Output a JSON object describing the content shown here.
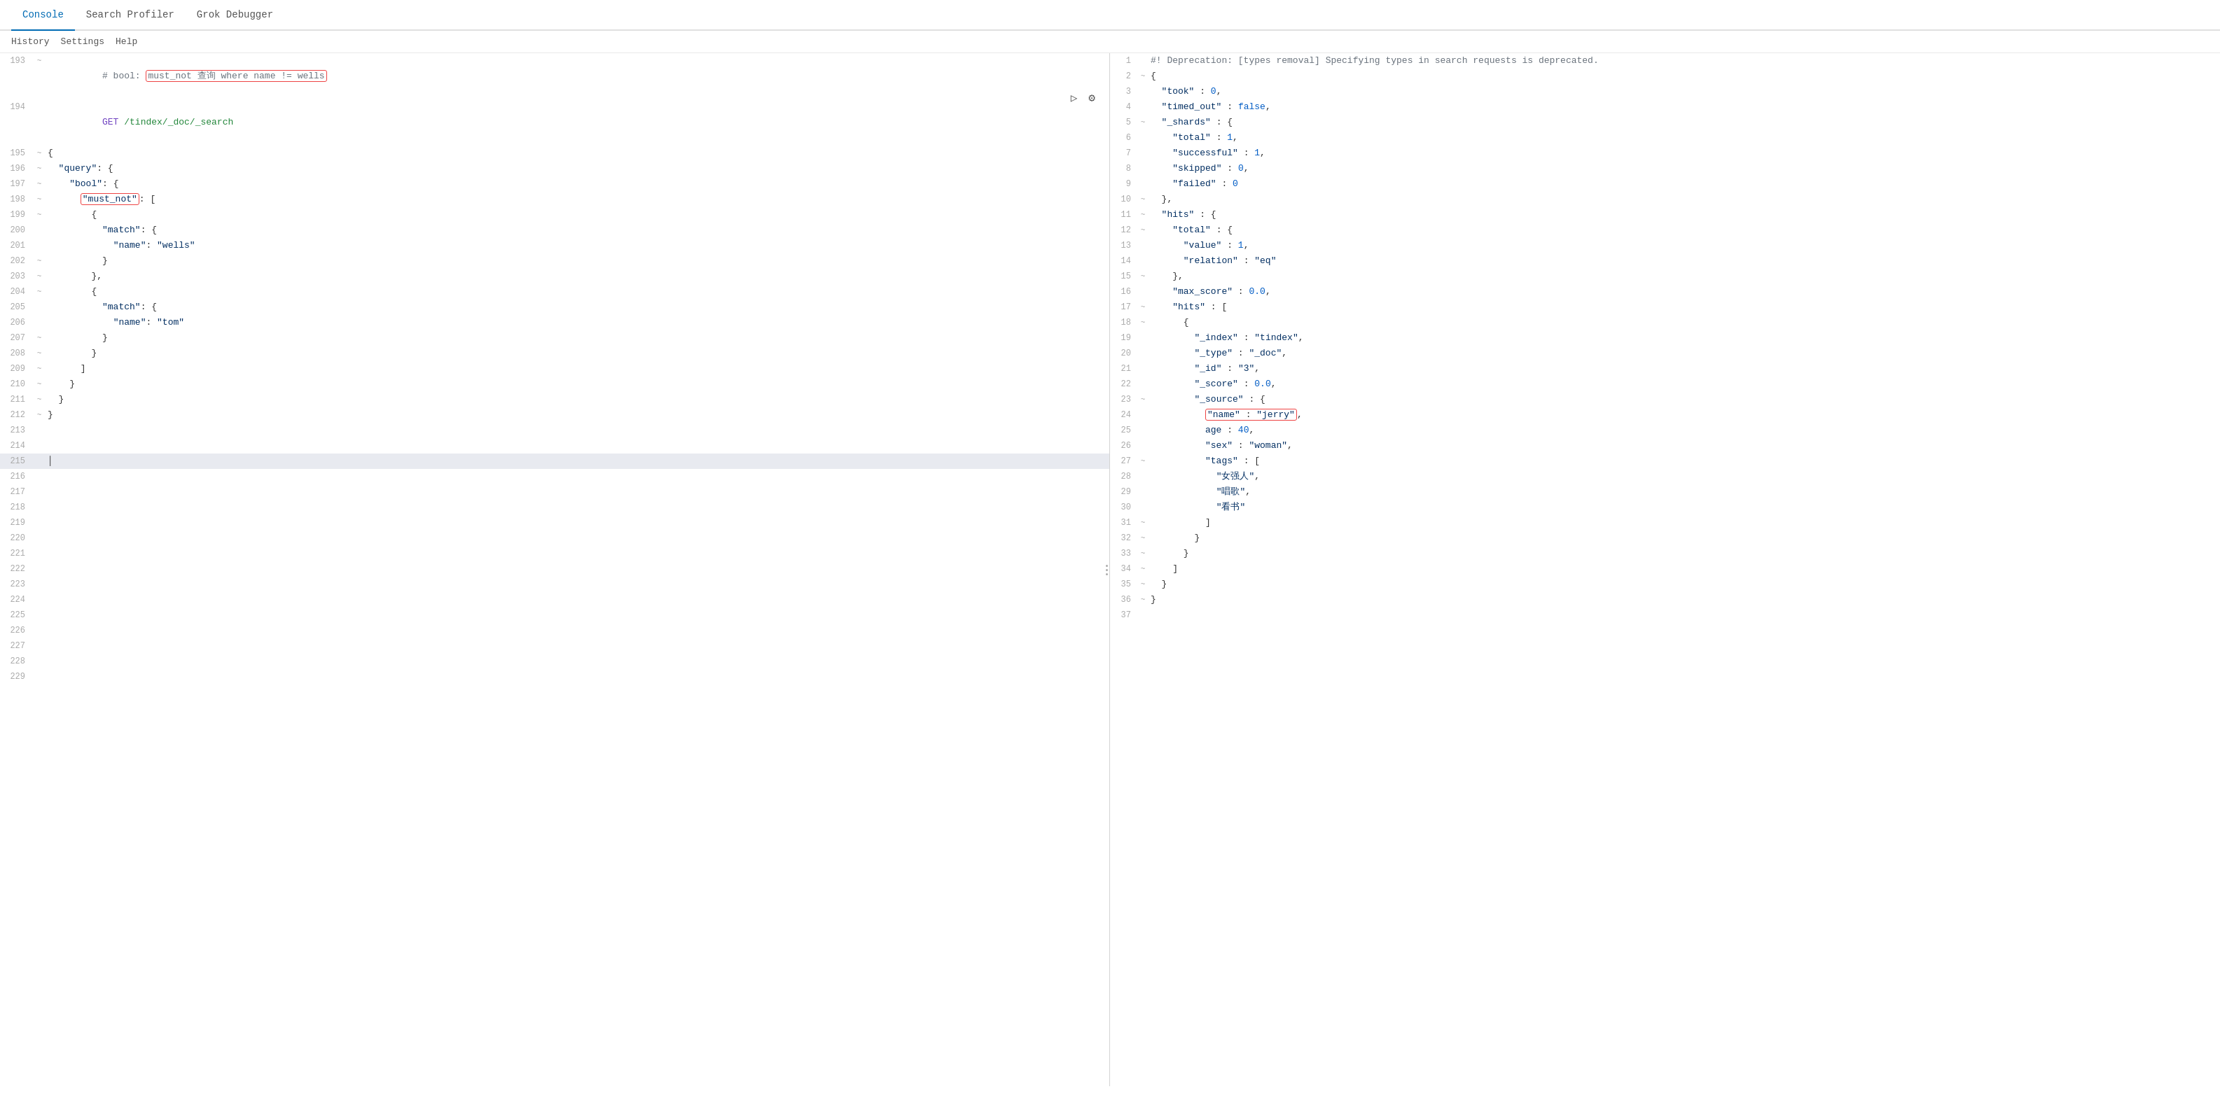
{
  "tabs": [
    {
      "label": "Console",
      "active": true
    },
    {
      "label": "Search Profiler",
      "active": false
    },
    {
      "label": "Grok Debugger",
      "active": false
    }
  ],
  "secondary_nav": [
    {
      "label": "History"
    },
    {
      "label": "Settings"
    },
    {
      "label": "Help"
    }
  ],
  "editor": {
    "lines": [
      {
        "num": 193,
        "fold": "~",
        "content": "# bool: ",
        "highlight": "must_not 查询 where name != wells",
        "highlighted": false,
        "comment": true
      },
      {
        "num": 194,
        "fold": null,
        "content": "GET /tindex/_doc/_search"
      },
      {
        "num": 195,
        "fold": "~",
        "content": "{"
      },
      {
        "num": 196,
        "fold": "~",
        "content": "  \"query\": {"
      },
      {
        "num": 197,
        "fold": "~",
        "content": "    \"bool\": {"
      },
      {
        "num": 198,
        "fold": "~",
        "content": "      \"must_not\": [",
        "boxed": true
      },
      {
        "num": 199,
        "fold": "~",
        "content": "        {"
      },
      {
        "num": 200,
        "fold": null,
        "content": "          \"match\": {"
      },
      {
        "num": 201,
        "fold": null,
        "content": "            \"name\": \"wells\""
      },
      {
        "num": 202,
        "fold": "~",
        "content": "          }"
      },
      {
        "num": 203,
        "fold": "~",
        "content": "        },"
      },
      {
        "num": 204,
        "fold": "~",
        "content": "        {"
      },
      {
        "num": 205,
        "fold": null,
        "content": "          \"match\": {"
      },
      {
        "num": 206,
        "fold": null,
        "content": "            \"name\": \"tom\""
      },
      {
        "num": 207,
        "fold": "~",
        "content": "          }"
      },
      {
        "num": 208,
        "fold": "~",
        "content": "        }"
      },
      {
        "num": 209,
        "fold": "~",
        "content": "      ]"
      },
      {
        "num": 210,
        "fold": "~",
        "content": "    }"
      },
      {
        "num": 211,
        "fold": "~",
        "content": "  }"
      },
      {
        "num": 212,
        "fold": "~",
        "content": "}"
      },
      {
        "num": 213,
        "fold": null,
        "content": ""
      },
      {
        "num": 214,
        "fold": null,
        "content": ""
      },
      {
        "num": 215,
        "fold": null,
        "content": "",
        "cursor": true
      },
      {
        "num": 216,
        "fold": null,
        "content": ""
      },
      {
        "num": 217,
        "fold": null,
        "content": ""
      },
      {
        "num": 218,
        "fold": null,
        "content": ""
      },
      {
        "num": 219,
        "fold": null,
        "content": ""
      },
      {
        "num": 220,
        "fold": null,
        "content": ""
      },
      {
        "num": 221,
        "fold": null,
        "content": ""
      },
      {
        "num": 222,
        "fold": null,
        "content": ""
      },
      {
        "num": 223,
        "fold": null,
        "content": ""
      },
      {
        "num": 224,
        "fold": null,
        "content": ""
      },
      {
        "num": 225,
        "fold": null,
        "content": ""
      },
      {
        "num": 226,
        "fold": null,
        "content": ""
      },
      {
        "num": 227,
        "fold": null,
        "content": ""
      },
      {
        "num": 228,
        "fold": null,
        "content": ""
      },
      {
        "num": 229,
        "fold": null,
        "content": ""
      }
    ]
  },
  "output": {
    "lines": [
      {
        "num": 1,
        "fold": null,
        "content": "#! Deprecation: [types removal] Specifying types in search requests is deprecated.",
        "comment": true
      },
      {
        "num": 2,
        "fold": "~",
        "content": "{"
      },
      {
        "num": 3,
        "fold": null,
        "content": "  \"took\" : 0,"
      },
      {
        "num": 4,
        "fold": null,
        "content": "  \"timed_out\" : false,"
      },
      {
        "num": 5,
        "fold": "~",
        "content": "  \"_shards\" : {"
      },
      {
        "num": 6,
        "fold": null,
        "content": "    \"total\" : 1,"
      },
      {
        "num": 7,
        "fold": null,
        "content": "    \"successful\" : 1,"
      },
      {
        "num": 8,
        "fold": null,
        "content": "    \"skipped\" : 0,"
      },
      {
        "num": 9,
        "fold": null,
        "content": "    \"failed\" : 0"
      },
      {
        "num": 10,
        "fold": "~",
        "content": "  },"
      },
      {
        "num": 11,
        "fold": "~",
        "content": "  \"hits\" : {"
      },
      {
        "num": 12,
        "fold": "~",
        "content": "    \"total\" : {"
      },
      {
        "num": 13,
        "fold": null,
        "content": "      \"value\" : 1,"
      },
      {
        "num": 14,
        "fold": null,
        "content": "      \"relation\" : \"eq\""
      },
      {
        "num": 15,
        "fold": "~",
        "content": "    },"
      },
      {
        "num": 16,
        "fold": null,
        "content": "    \"max_score\" : 0.0,"
      },
      {
        "num": 17,
        "fold": "~",
        "content": "    \"hits\" : ["
      },
      {
        "num": 18,
        "fold": "~",
        "content": "      {"
      },
      {
        "num": 19,
        "fold": null,
        "content": "        \"_index\" : \"tindex\","
      },
      {
        "num": 20,
        "fold": null,
        "content": "        \"_type\" : \"_doc\","
      },
      {
        "num": 21,
        "fold": null,
        "content": "        \"_id\" : \"3\","
      },
      {
        "num": 22,
        "fold": null,
        "content": "        \"_score\" : 0.0,"
      },
      {
        "num": 23,
        "fold": "~",
        "content": "        \"_source\" : {"
      },
      {
        "num": 24,
        "fold": null,
        "content": "          \"name\" : \"jerry\",",
        "boxed": true
      },
      {
        "num": 25,
        "fold": null,
        "content": "          age : 40,"
      },
      {
        "num": 26,
        "fold": null,
        "content": "          \"sex\" : \"woman\","
      },
      {
        "num": 27,
        "fold": "~",
        "content": "          \"tags\" : ["
      },
      {
        "num": 28,
        "fold": null,
        "content": "            \"女强人\","
      },
      {
        "num": 29,
        "fold": null,
        "content": "            \"唱歌\","
      },
      {
        "num": 30,
        "fold": null,
        "content": "            \"看书\""
      },
      {
        "num": 31,
        "fold": "~",
        "content": "          ]"
      },
      {
        "num": 32,
        "fold": "~",
        "content": "        }"
      },
      {
        "num": 33,
        "fold": "~",
        "content": "      }"
      },
      {
        "num": 34,
        "fold": "~",
        "content": "    ]"
      },
      {
        "num": 35,
        "fold": "~",
        "content": "  }"
      },
      {
        "num": 36,
        "fold": "~",
        "content": "}"
      },
      {
        "num": 37,
        "fold": null,
        "content": ""
      }
    ]
  },
  "icons": {
    "run": "▷",
    "settings": "⚙",
    "drag": "⋮⋮"
  }
}
